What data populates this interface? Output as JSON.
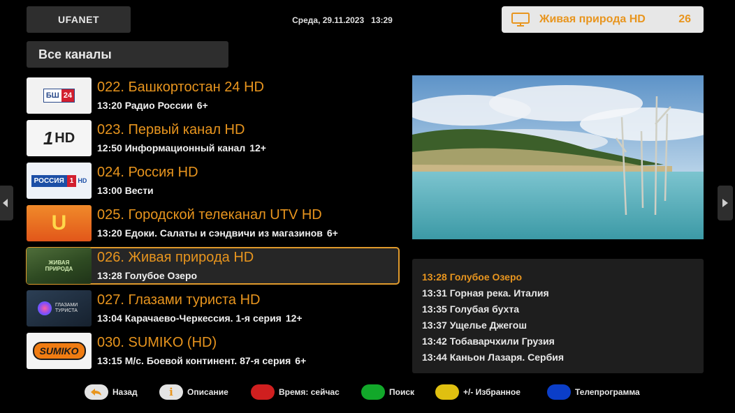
{
  "header": {
    "brand": "UFANET",
    "date": "Среда, 29.11.2023",
    "time": "13:29",
    "now_playing": {
      "title": "Живая природа HD",
      "number": "26",
      "icon": "tv-icon"
    }
  },
  "section_title": "Все каналы",
  "channels": [
    {
      "name": "022. Башкортостан 24 HD",
      "program": "13:20 Радио России",
      "age": "6+",
      "logo_text": "БШ 24"
    },
    {
      "name": "023. Первый канал HD",
      "program": "12:50 Информационный канал",
      "age": "12+",
      "logo_text": "1HD"
    },
    {
      "name": "024. Россия HD",
      "program": "13:00 Вести",
      "age": "",
      "logo_text": "РОССИЯ 1 HD"
    },
    {
      "name": "025. Городской телеканал UTV HD",
      "program": "13:20 Едоки. Салаты и сэндвичи из магазинов",
      "age": "6+",
      "logo_text": "U"
    },
    {
      "name": "026. Живая природа HD",
      "program": "13:28 Голубое Озеро",
      "age": "",
      "logo_text": "ЖИВАЯ ПРИРОДА",
      "active": true
    },
    {
      "name": "027. Глазами туриста HD",
      "program": "13:04 Карачаево-Черкессия. 1-я серия",
      "age": "12+",
      "logo_text": "ГЛАЗАМИ ТУРИСТА"
    },
    {
      "name": "030. SUMIKO (HD)",
      "program": "13:15 М/с. Боевой континент. 87-я серия",
      "age": "6+",
      "logo_text": "SUMIKO"
    }
  ],
  "schedule": [
    "13:28 Голубое Озеро",
    "13:31 Горная река. Италия",
    "13:35 Голубая бухта",
    "13:37 Ущелье Джегош",
    "13:42 Тобаварчхили Грузия",
    "13:44 Каньон Лазаря. Сербия"
  ],
  "legend": {
    "back": "Назад",
    "info": "Описание",
    "red": "Время: сейчас",
    "green": "Поиск",
    "yellow": "+/- Избранное",
    "blue": "Телепрограмма"
  },
  "colors": {
    "accent": "#e8951e",
    "red": "#d01f1f",
    "green": "#12a82a",
    "yellow": "#e0c010",
    "blue": "#0b3ec8"
  }
}
